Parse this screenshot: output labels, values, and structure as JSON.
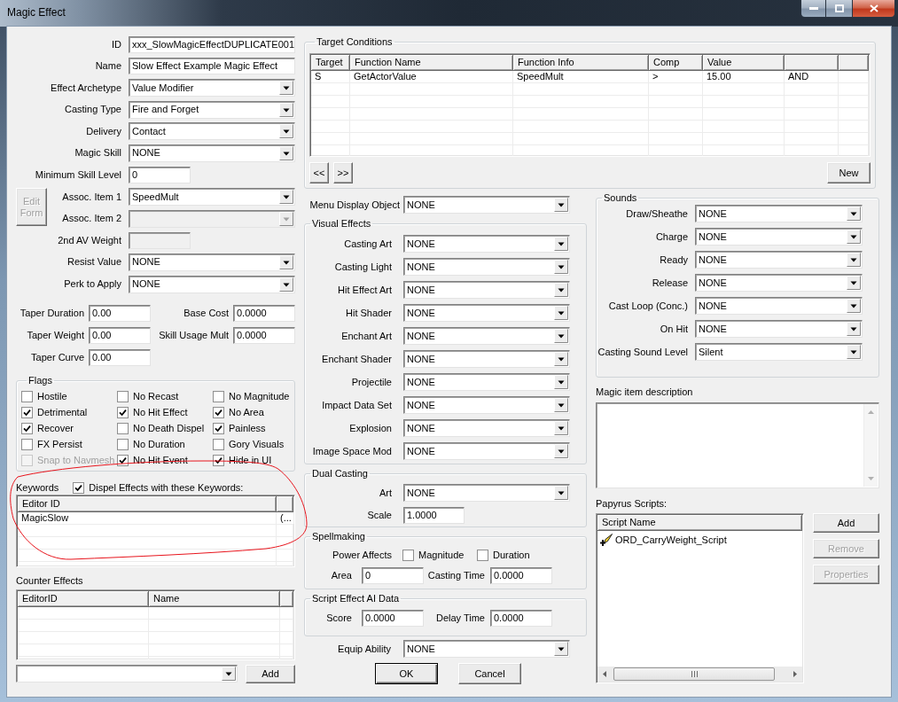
{
  "window": {
    "title": "Magic Effect"
  },
  "general": {
    "fields": [
      {
        "label": "ID",
        "kind": "text",
        "value": "xxx_SlowMagicEffectDUPLICATE001",
        "disabled": false
      },
      {
        "label": "Name",
        "kind": "text",
        "value": "Slow Effect Example Magic Effect",
        "disabled": false
      },
      {
        "label": "Effect Archetype",
        "kind": "dropdown",
        "value": "Value Modifier",
        "disabled": false
      },
      {
        "label": "Casting Type",
        "kind": "dropdown",
        "value": "Fire and Forget",
        "disabled": false
      },
      {
        "label": "Delivery",
        "kind": "dropdown",
        "value": "Contact",
        "disabled": false
      },
      {
        "label": "Magic Skill",
        "kind": "dropdown",
        "value": "NONE",
        "disabled": false
      },
      {
        "label": "Minimum Skill Level",
        "kind": "number",
        "value": "0",
        "disabled": false
      },
      {
        "label": "Assoc. Item 1",
        "kind": "dropdown",
        "value": "SpeedMult",
        "disabled": false
      },
      {
        "label": "Assoc. Item 2",
        "kind": "dropdown",
        "disabled": true
      },
      {
        "label": "2nd AV Weight",
        "kind": "number",
        "disabled": true
      },
      {
        "label": "Resist Value",
        "kind": "dropdown",
        "value": "NONE",
        "disabled": false
      },
      {
        "label": "Perk to Apply",
        "kind": "dropdown",
        "value": "NONE",
        "disabled": false
      }
    ],
    "edit_form_button": {
      "label": "Edit Form",
      "disabled": true
    }
  },
  "costs": [
    {
      "label": "Taper Duration",
      "value": "0.00"
    },
    {
      "label": "Base Cost",
      "value": "0.0000"
    },
    {
      "label": "Taper Weight",
      "value": "0.00"
    },
    {
      "label": "Skill Usage Mult",
      "value": "0.0000"
    },
    {
      "label": "Taper Curve",
      "value": "0.00"
    }
  ],
  "flags": {
    "title": "Flags",
    "items": [
      {
        "label": "Hostile",
        "checked": false,
        "disabled": false
      },
      {
        "label": "No Recast",
        "checked": false,
        "disabled": false
      },
      {
        "label": "No Magnitude",
        "checked": false,
        "disabled": false
      },
      {
        "label": "Detrimental",
        "checked": true,
        "disabled": false
      },
      {
        "label": "No Hit Effect",
        "checked": true,
        "disabled": false
      },
      {
        "label": "No Area",
        "checked": true,
        "disabled": false
      },
      {
        "label": "Recover",
        "checked": true,
        "disabled": false
      },
      {
        "label": "No Death Dispel",
        "checked": false,
        "disabled": false
      },
      {
        "label": "Painless",
        "checked": true,
        "disabled": false
      },
      {
        "label": "FX Persist",
        "checked": false,
        "disabled": false
      },
      {
        "label": "No Duration",
        "checked": false,
        "disabled": false
      },
      {
        "label": "Gory Visuals",
        "checked": false,
        "disabled": false
      },
      {
        "label": "Snap to Navmesh",
        "checked": false,
        "disabled": true
      },
      {
        "label": "No Hit Event",
        "checked": true,
        "disabled": false
      },
      {
        "label": "Hide in UI",
        "checked": true,
        "disabled": false
      }
    ]
  },
  "keywords": {
    "label": "Keywords",
    "dispel": {
      "label": "Dispel Effects with these Keywords:",
      "checked": true
    },
    "columns": [
      "Editor ID"
    ],
    "rows": [
      [
        "MagicSlow",
        "(..."
      ]
    ]
  },
  "counter_effects": {
    "label": "Counter Effects",
    "columns": [
      "EditorID",
      "Name"
    ],
    "add_button": "Add"
  },
  "target_conditions": {
    "title": "Target Conditions",
    "columns": [
      "Target",
      "Function Name",
      "Function Info",
      "Comp",
      "Value"
    ],
    "rows": [
      [
        "S",
        "GetActorValue",
        "SpeedMult",
        ">",
        "15.00",
        "AND"
      ]
    ],
    "buttons": [
      "<<",
      ">>"
    ],
    "new_button": "New"
  },
  "menu_display_object": {
    "label": "Menu Display Object",
    "value": "NONE"
  },
  "visual_effects": {
    "title": "Visual Effects",
    "fields": [
      {
        "label": "Casting Art",
        "value": "NONE"
      },
      {
        "label": "Casting Light",
        "value": "NONE"
      },
      {
        "label": "Hit Effect Art",
        "value": "NONE"
      },
      {
        "label": "Hit Shader",
        "value": "NONE"
      },
      {
        "label": "Enchant Art",
        "value": "NONE"
      },
      {
        "label": "Enchant Shader",
        "value": "NONE"
      },
      {
        "label": "Projectile",
        "value": "NONE"
      },
      {
        "label": "Impact Data Set",
        "value": "NONE"
      },
      {
        "label": "Explosion",
        "value": "NONE"
      },
      {
        "label": "Image Space Mod",
        "value": "NONE"
      }
    ]
  },
  "dual_casting": {
    "title": "Dual Casting",
    "fields": [
      {
        "label": "Art",
        "kind": "dropdown",
        "value": "NONE"
      },
      {
        "label": "Scale",
        "kind": "number",
        "value": "1.0000"
      }
    ]
  },
  "spellmaking": {
    "title": "Spellmaking",
    "power_affects": {
      "label": "Power Affects",
      "options": [
        {
          "label": "Magnitude",
          "checked": false
        },
        {
          "label": "Duration",
          "checked": false
        }
      ]
    },
    "fields": [
      {
        "label": "Area",
        "value": "0"
      },
      {
        "label": "Casting Time",
        "value": "0.0000"
      }
    ]
  },
  "script_ai": {
    "title": "Script Effect AI Data",
    "fields": [
      {
        "label": "Score",
        "value": "0.0000"
      },
      {
        "label": "Delay Time",
        "value": "0.0000"
      }
    ]
  },
  "equip_ability": {
    "label": "Equip Ability",
    "value": "NONE"
  },
  "dialog_buttons": [
    {
      "label": "OK",
      "default": true
    },
    {
      "label": "Cancel",
      "default": false
    }
  ],
  "sounds": {
    "title": "Sounds",
    "fields": [
      {
        "label": "Draw/Sheathe",
        "value": "NONE"
      },
      {
        "label": "Charge",
        "value": "NONE"
      },
      {
        "label": "Ready",
        "value": "NONE"
      },
      {
        "label": "Release",
        "value": "NONE"
      },
      {
        "label": "Cast Loop (Conc.)",
        "value": "NONE"
      },
      {
        "label": "On Hit",
        "value": "NONE"
      },
      {
        "label": "Casting Sound Level",
        "value": "Silent"
      }
    ]
  },
  "description": {
    "label": "Magic item description"
  },
  "papyrus": {
    "label": "Papyrus Scripts:",
    "columns": [
      "Script Name"
    ],
    "rows": [
      [
        "ORD_CarryWeight_Script"
      ]
    ],
    "buttons": [
      {
        "label": "Add",
        "disabled": false
      },
      {
        "label": "Remove",
        "disabled": true
      },
      {
        "label": "Properties",
        "disabled": true
      }
    ]
  },
  "markup": [
    {
      "kind": "ellipse"
    }
  ]
}
